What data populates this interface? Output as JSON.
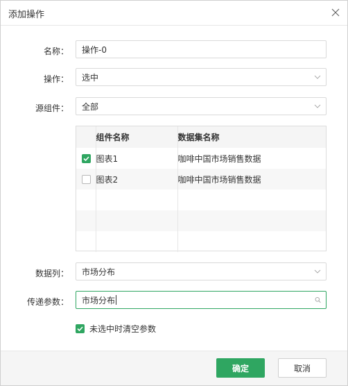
{
  "dialog": {
    "title": "添加操作",
    "close_icon": "close-icon"
  },
  "form": {
    "name_label": "名称：",
    "name_value": "操作-0",
    "operation_label": "操作：",
    "operation_value": "选中",
    "source_label": "源组件：",
    "source_value": "全部",
    "datacol_label": "数据列：",
    "datacol_value": "市场分布",
    "param_label": "传递参数：",
    "param_value": "市场分布",
    "param_icon": "search-icon",
    "dropdown_icon": "chevron-down-icon"
  },
  "table": {
    "headers": [
      "",
      "组件名称",
      "数据集名称"
    ],
    "rows": [
      {
        "checked": true,
        "component": "图表1",
        "dataset": "咖啡中国市场销售数据"
      },
      {
        "checked": false,
        "component": "图表2",
        "dataset": "咖啡中国市场销售数据"
      }
    ]
  },
  "option": {
    "label": "未选中时清空参数",
    "checked": true
  },
  "footer": {
    "ok_label": "确定",
    "cancel_label": "取消"
  },
  "colors": {
    "accent": "#2fa661",
    "border": "#d9d9d9",
    "header_bg": "#f5f5f5"
  }
}
